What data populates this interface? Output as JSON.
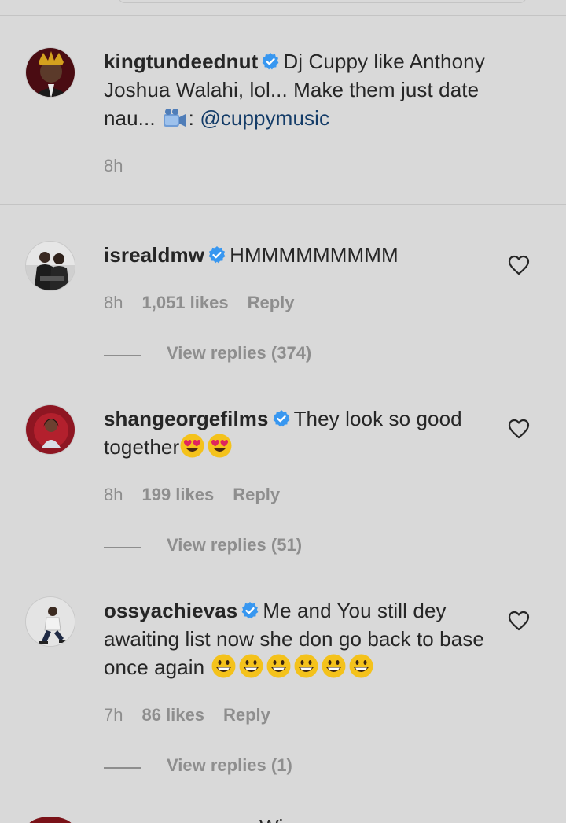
{
  "caption": {
    "username": "kingtundeednut",
    "text_before": "Dj Cuppy like Anthony Joshua Walahi, lol... Make them just date nau...",
    "text_after": ":",
    "mention": "@cuppymusic",
    "time": "8h"
  },
  "comments": [
    {
      "username": "isrealdmw",
      "text": "HMMMMMMMMM",
      "time": "8h",
      "likes": "1,051 likes",
      "reply_label": "Reply",
      "view_replies": "View replies (374)"
    },
    {
      "username": "shangeorgefilms",
      "text": "They look so good together",
      "time": "8h",
      "likes": "199 likes",
      "reply_label": "Reply",
      "view_replies": "View replies (51)"
    },
    {
      "username": "ossyachievas",
      "text": "Me and You still dey awaiting list now she don go back to base once again",
      "time": "7h",
      "likes": "86 likes",
      "reply_label": "Reply",
      "view_replies": "View replies (1)"
    }
  ],
  "bottom_peek_text": "Wi",
  "icons": {
    "verified": "verified-badge-icon",
    "heart": "heart-icon",
    "camera": "video-camera-emoji",
    "heart_eyes": "heart-eyes-emoji",
    "grin": "grinning-face-emoji"
  },
  "colors": {
    "background": "#d9d9d9",
    "text": "#262626",
    "meta": "#8e8e8e",
    "verified": "#3897f0",
    "mention": "#143c68"
  }
}
